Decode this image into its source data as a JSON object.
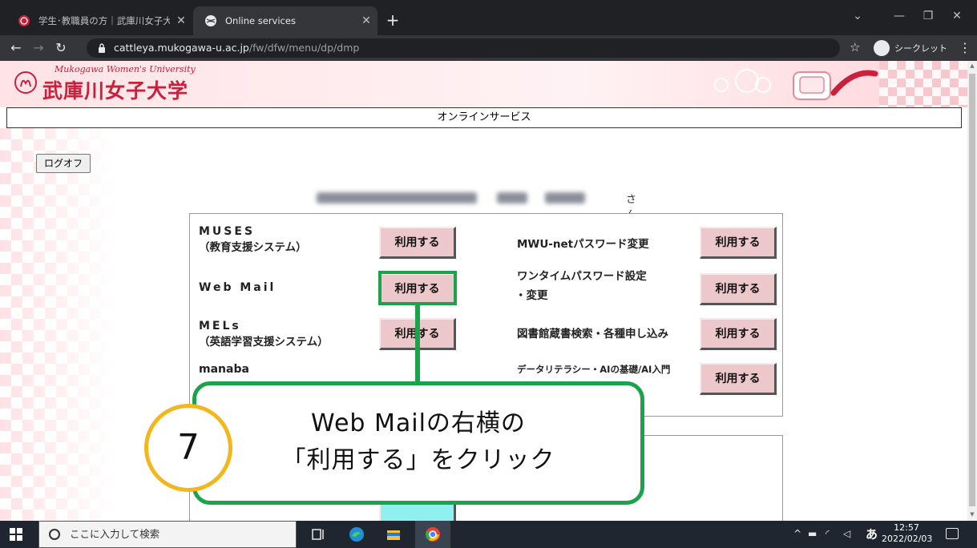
{
  "browser": {
    "tabs": [
      {
        "label": "学生･教職員の方｜武庫川女子大",
        "active": false
      },
      {
        "label": "Online services",
        "active": true
      }
    ],
    "new_tab": "+",
    "url_host": "cattleya.mukogawa-u.ac.jp",
    "url_path": "/fw/dfw/menu/dp/dmp",
    "incognito_label": "シークレット",
    "window_controls": [
      "minimize",
      "maximize",
      "close"
    ]
  },
  "site": {
    "logo_en": "Mukogawa Women's University",
    "logo_ja": "武庫川女子大学",
    "service_title": "オンラインサービス",
    "logoff_label": "ログオフ",
    "user_suffix": "さん"
  },
  "services_left": [
    {
      "name": "MUSES",
      "sub": "（教育支援システム）",
      "button": "利用する"
    },
    {
      "name": "Web Mail",
      "sub": "",
      "button": "利用する"
    },
    {
      "name": "MELs",
      "sub": "（英語学習支援システム）",
      "button": "利用する"
    },
    {
      "name": "manaba",
      "sub": "",
      "button": ""
    }
  ],
  "services_right": [
    {
      "name": "MWU-netパスワード変更",
      "sub": "",
      "button": "利用する"
    },
    {
      "name": "ワンタイムパスワード設定",
      "sub": "・変更",
      "button": "利用する"
    },
    {
      "name": "図書館蔵書検索・各種申し込み",
      "sub": "",
      "button": "利用する"
    },
    {
      "name": "データリテラシー・AIの基礎/AI入門",
      "sub": "",
      "button": "利用する"
    }
  ],
  "callout": {
    "step": "7",
    "line1": "Web Mailの右横の",
    "line2": "「利用する」をクリック"
  },
  "taskbar": {
    "search_placeholder": "ここに入力して検索",
    "ime": "あ",
    "time": "12:57",
    "date": "2022/02/03"
  },
  "colors": {
    "brand_red": "#c9203c",
    "highlight_green": "#1aa34a",
    "step_yellow": "#f3b61d",
    "button_pink": "#ecc8cb"
  },
  "icons": [
    "chrome-icon",
    "back-icon",
    "forward-icon",
    "reload-icon",
    "lock-icon",
    "star-icon",
    "incognito-icon",
    "menu-icon",
    "windows-logo-icon",
    "search-icon",
    "task-view-icon",
    "edge-icon",
    "file-explorer-icon",
    "chrome-taskbar-icon",
    "notification-icon"
  ]
}
